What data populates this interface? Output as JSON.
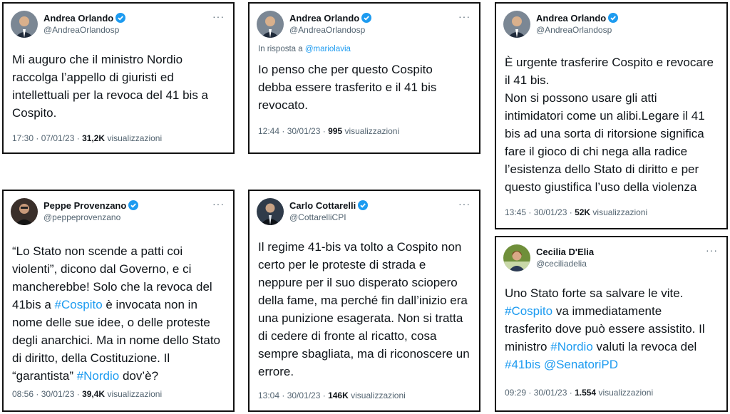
{
  "tweets": [
    {
      "name": "Andrea Orlando",
      "handle": "@AndreaOrlandosp",
      "more": "···",
      "text": "Mi auguro che il ministro Nordio\nraccolga l’appello di giuristi ed\nintellettuali per la revoca del 41 bis a\nCospito.",
      "time": "17:30 · 07/01/23 · ",
      "views": "31,2K",
      "views_label": " visualizzazioni"
    },
    {
      "name": "Andrea Orlando",
      "handle": "@AndreaOrlandosp",
      "more": "···",
      "reply_prefix": "In risposta a ",
      "reply_mention": "@mariolavia",
      "text": "Io penso che per questo Cospito\ndebba essere trasferito e il 41 bis\nrevocato.",
      "time": "12:44 · 30/01/23 · ",
      "views": "995",
      "views_label": " visualizzazioni"
    },
    {
      "name": "Andrea Orlando",
      "handle": "@AndreaOrlandosp",
      "more": "···",
      "text": "È urgente trasferire Cospito e revocare\nil 41 bis.\nNon si possono usare gli atti\nintimidatori come un alibi.Legare il 41\nbis ad una sorta di ritorsione significa\nfare il gioco di chi nega alla radice\nl’esistenza dello Stato di diritto e per\nquesto giustifica l’uso della violenza",
      "time": "13:45 · 30/01/23 · ",
      "views": "52K",
      "views_label": " visualizzazioni"
    },
    {
      "name": "Peppe Provenzano",
      "handle": "@peppeprovenzano",
      "more": "···",
      "text_parts": [
        "“Lo Stato non scende a patti coi\nviolenti”, dicono dal Governo, e ci\nmancherebbe! Solo che la revoca del\n41bis a ",
        "#Cospito",
        " è invocata non in\nnome delle sue idee, o delle proteste\ndegli anarchici. Ma in nome dello Stato\ndi diritto, della Costituzione. Il\n“garantista” ",
        "#Nordio",
        " dov’è?"
      ],
      "time": "08:56 · 30/01/23 · ",
      "views": "39,4K",
      "views_label": " visualizzazioni"
    },
    {
      "name": "Carlo Cottarelli",
      "handle": "@CottarelliCPI",
      "more": "···",
      "text": "Il regime 41-bis va tolto a Cospito non\ncerto per le proteste di strada e\nneppure per il suo disperato sciopero\ndella fame, ma perché fin dall’inizio era\nuna punizione esagerata. Non si tratta\ndi cedere di fronte al ricatto, cosa\nsempre sbagliata, ma di riconoscere un\nerrore.",
      "time": "13:04 · 30/01/23 · ",
      "views": "146K",
      "views_label": " visualizzazioni"
    },
    {
      "name": "Cecilia D'Elia",
      "handle": "@ceciliadelia",
      "more": "···",
      "text_parts": [
        "Uno Stato forte sa salvare le vite.\n",
        "#Cospito",
        " va immediatamente\ntrasferito dove può essere assistito. Il\nministro ",
        "#Nordio",
        " valuti la revoca del\n",
        "#41bis @SenatoriPD",
        ""
      ],
      "time": "09:29 · 30/01/23 · ",
      "views": "1.554",
      "views_label": " visualizzazioni"
    }
  ],
  "colors": {
    "link": "#1d9bf0",
    "verified": "#1d9bf0",
    "muted": "#536471",
    "border": "#111111"
  }
}
